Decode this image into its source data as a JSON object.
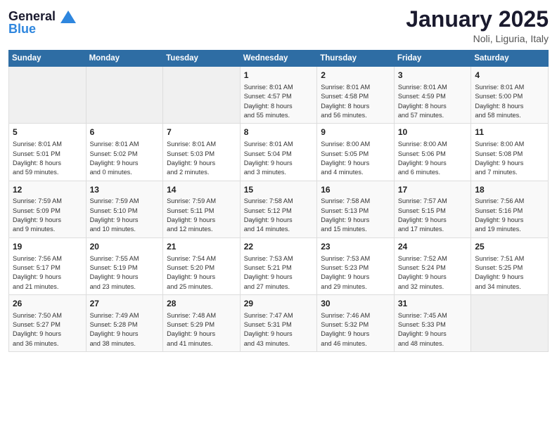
{
  "header": {
    "logo_line1": "General",
    "logo_line2": "Blue",
    "month": "January 2025",
    "location": "Noli, Liguria, Italy"
  },
  "weekdays": [
    "Sunday",
    "Monday",
    "Tuesday",
    "Wednesday",
    "Thursday",
    "Friday",
    "Saturday"
  ],
  "weeks": [
    [
      {
        "day": "",
        "info": ""
      },
      {
        "day": "",
        "info": ""
      },
      {
        "day": "",
        "info": ""
      },
      {
        "day": "1",
        "info": "Sunrise: 8:01 AM\nSunset: 4:57 PM\nDaylight: 8 hours\nand 55 minutes."
      },
      {
        "day": "2",
        "info": "Sunrise: 8:01 AM\nSunset: 4:58 PM\nDaylight: 8 hours\nand 56 minutes."
      },
      {
        "day": "3",
        "info": "Sunrise: 8:01 AM\nSunset: 4:59 PM\nDaylight: 8 hours\nand 57 minutes."
      },
      {
        "day": "4",
        "info": "Sunrise: 8:01 AM\nSunset: 5:00 PM\nDaylight: 8 hours\nand 58 minutes."
      }
    ],
    [
      {
        "day": "5",
        "info": "Sunrise: 8:01 AM\nSunset: 5:01 PM\nDaylight: 8 hours\nand 59 minutes."
      },
      {
        "day": "6",
        "info": "Sunrise: 8:01 AM\nSunset: 5:02 PM\nDaylight: 9 hours\nand 0 minutes."
      },
      {
        "day": "7",
        "info": "Sunrise: 8:01 AM\nSunset: 5:03 PM\nDaylight: 9 hours\nand 2 minutes."
      },
      {
        "day": "8",
        "info": "Sunrise: 8:01 AM\nSunset: 5:04 PM\nDaylight: 9 hours\nand 3 minutes."
      },
      {
        "day": "9",
        "info": "Sunrise: 8:00 AM\nSunset: 5:05 PM\nDaylight: 9 hours\nand 4 minutes."
      },
      {
        "day": "10",
        "info": "Sunrise: 8:00 AM\nSunset: 5:06 PM\nDaylight: 9 hours\nand 6 minutes."
      },
      {
        "day": "11",
        "info": "Sunrise: 8:00 AM\nSunset: 5:08 PM\nDaylight: 9 hours\nand 7 minutes."
      }
    ],
    [
      {
        "day": "12",
        "info": "Sunrise: 7:59 AM\nSunset: 5:09 PM\nDaylight: 9 hours\nand 9 minutes."
      },
      {
        "day": "13",
        "info": "Sunrise: 7:59 AM\nSunset: 5:10 PM\nDaylight: 9 hours\nand 10 minutes."
      },
      {
        "day": "14",
        "info": "Sunrise: 7:59 AM\nSunset: 5:11 PM\nDaylight: 9 hours\nand 12 minutes."
      },
      {
        "day": "15",
        "info": "Sunrise: 7:58 AM\nSunset: 5:12 PM\nDaylight: 9 hours\nand 14 minutes."
      },
      {
        "day": "16",
        "info": "Sunrise: 7:58 AM\nSunset: 5:13 PM\nDaylight: 9 hours\nand 15 minutes."
      },
      {
        "day": "17",
        "info": "Sunrise: 7:57 AM\nSunset: 5:15 PM\nDaylight: 9 hours\nand 17 minutes."
      },
      {
        "day": "18",
        "info": "Sunrise: 7:56 AM\nSunset: 5:16 PM\nDaylight: 9 hours\nand 19 minutes."
      }
    ],
    [
      {
        "day": "19",
        "info": "Sunrise: 7:56 AM\nSunset: 5:17 PM\nDaylight: 9 hours\nand 21 minutes."
      },
      {
        "day": "20",
        "info": "Sunrise: 7:55 AM\nSunset: 5:19 PM\nDaylight: 9 hours\nand 23 minutes."
      },
      {
        "day": "21",
        "info": "Sunrise: 7:54 AM\nSunset: 5:20 PM\nDaylight: 9 hours\nand 25 minutes."
      },
      {
        "day": "22",
        "info": "Sunrise: 7:53 AM\nSunset: 5:21 PM\nDaylight: 9 hours\nand 27 minutes."
      },
      {
        "day": "23",
        "info": "Sunrise: 7:53 AM\nSunset: 5:23 PM\nDaylight: 9 hours\nand 29 minutes."
      },
      {
        "day": "24",
        "info": "Sunrise: 7:52 AM\nSunset: 5:24 PM\nDaylight: 9 hours\nand 32 minutes."
      },
      {
        "day": "25",
        "info": "Sunrise: 7:51 AM\nSunset: 5:25 PM\nDaylight: 9 hours\nand 34 minutes."
      }
    ],
    [
      {
        "day": "26",
        "info": "Sunrise: 7:50 AM\nSunset: 5:27 PM\nDaylight: 9 hours\nand 36 minutes."
      },
      {
        "day": "27",
        "info": "Sunrise: 7:49 AM\nSunset: 5:28 PM\nDaylight: 9 hours\nand 38 minutes."
      },
      {
        "day": "28",
        "info": "Sunrise: 7:48 AM\nSunset: 5:29 PM\nDaylight: 9 hours\nand 41 minutes."
      },
      {
        "day": "29",
        "info": "Sunrise: 7:47 AM\nSunset: 5:31 PM\nDaylight: 9 hours\nand 43 minutes."
      },
      {
        "day": "30",
        "info": "Sunrise: 7:46 AM\nSunset: 5:32 PM\nDaylight: 9 hours\nand 46 minutes."
      },
      {
        "day": "31",
        "info": "Sunrise: 7:45 AM\nSunset: 5:33 PM\nDaylight: 9 hours\nand 48 minutes."
      },
      {
        "day": "",
        "info": ""
      }
    ]
  ]
}
